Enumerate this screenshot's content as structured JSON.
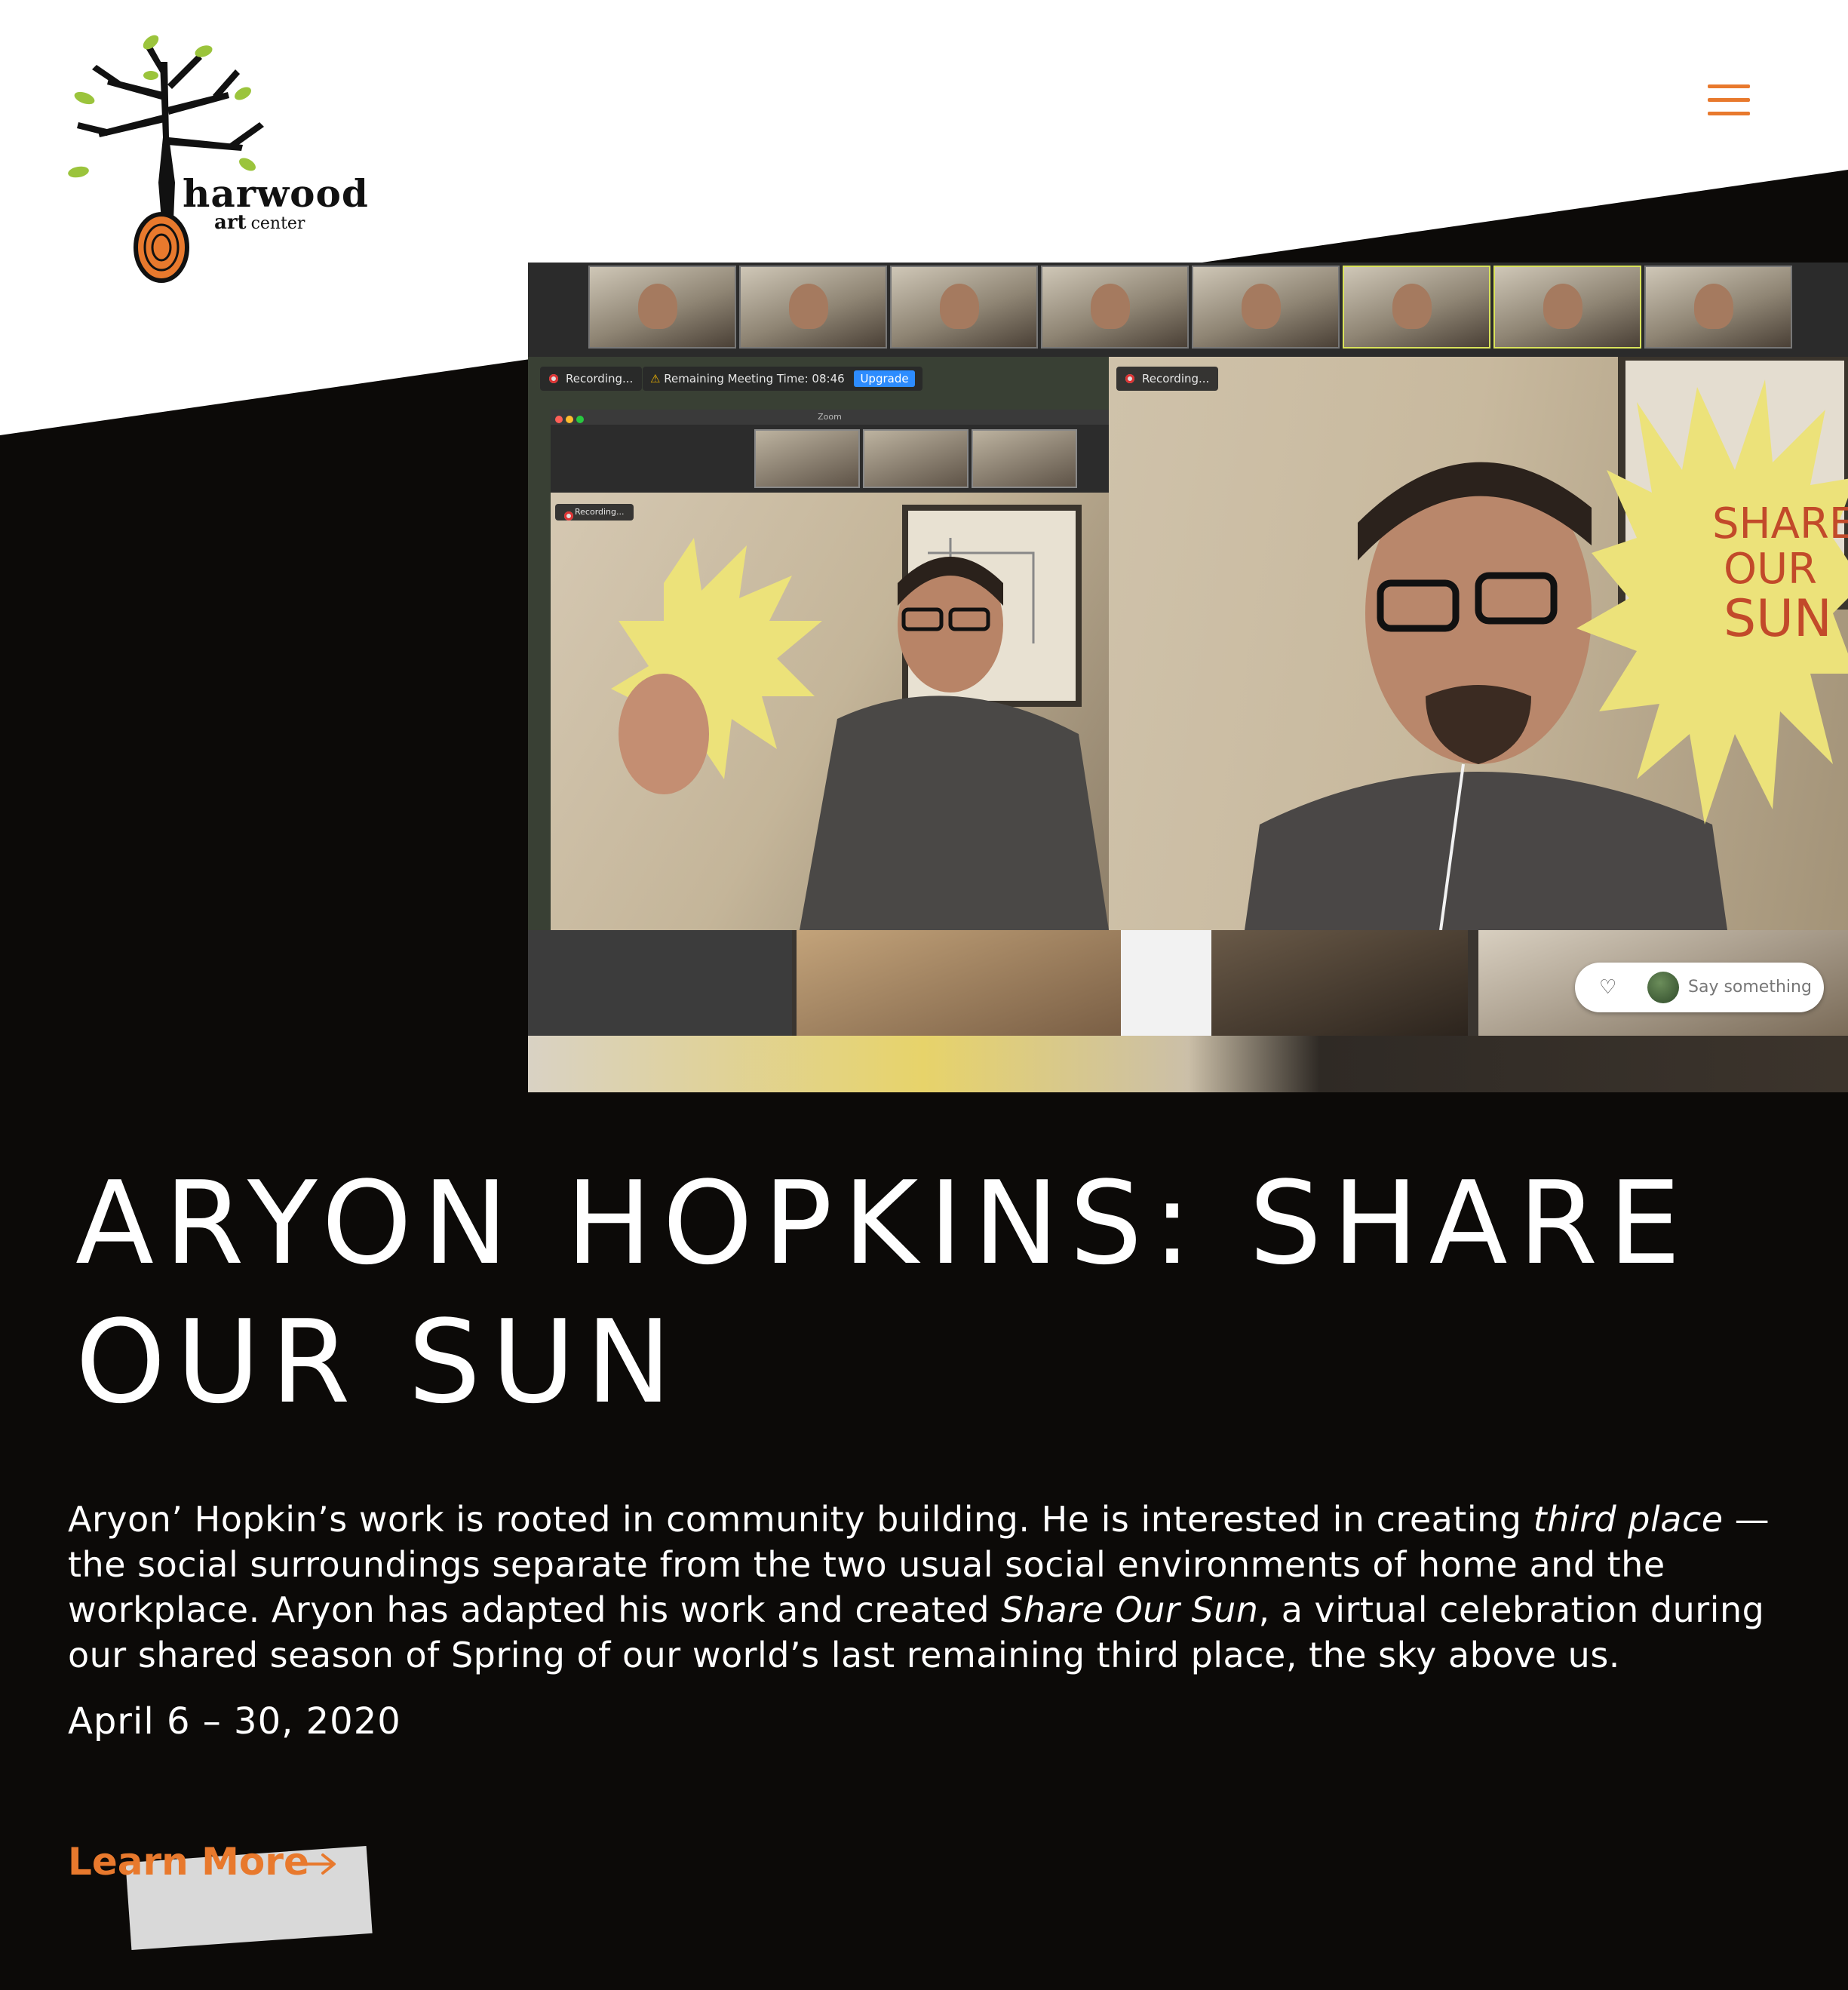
{
  "logo": {
    "name_line1": "harwood",
    "name_line2_a": "art",
    "name_line2_b": "center",
    "colors": {
      "leaf": "#9bc43c",
      "branch": "#111111",
      "accent": "#e8792d"
    }
  },
  "header": {
    "menu_icon": "hamburger-menu-icon",
    "accent_color": "#e8792d"
  },
  "hero": {
    "recording_label_left": "Recording...",
    "recording_label_right": "Recording...",
    "recording_label_inner": "Recording...",
    "meeting_time_label": "Remaining Meeting Time: 08:46",
    "upgrade_label": "Upgrade",
    "zoom_window_title": "Zoom",
    "sign_text_line1": "SHARE",
    "sign_text_line2": "OUR",
    "sign_text_line3": "SUN",
    "say_something": "Say something"
  },
  "main": {
    "title": "ARYON HOPKINS: SHARE OUR SUN",
    "description_part1": "Aryon’ Hopkin’s work is rooted in community building. He is interested in creating ",
    "description_em1": "third place",
    "description_part2": " — the social surroundings separate from the two usual social environments of home and the workplace. Aryon has adapted his work and created ",
    "description_em2": "Share Our Sun",
    "description_part3": ", a virtual celebration during our shared season of Spring of our world’s last remaining third place, the sky above us.",
    "dates": "April 6 – 30, 2020",
    "learn_more_label": "Learn More"
  }
}
